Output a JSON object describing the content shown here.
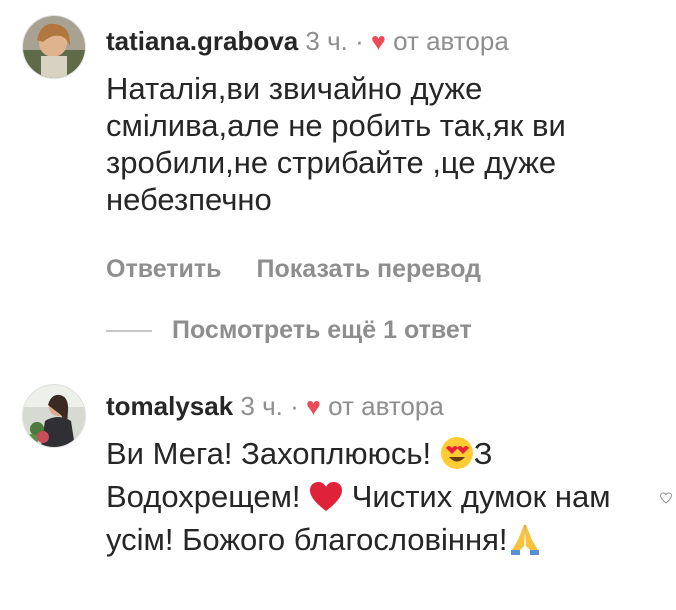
{
  "comments": [
    {
      "username": "tatiana.grabova",
      "time": "3 ч.",
      "separator": "·",
      "author_label": "от автора",
      "text": "Наталія,ви  звичайно дуже смілива,але не робить так,як ви зробили,не стрибайте ,це дуже небезпечно",
      "reply_label": "Ответить",
      "translate_label": "Показать перевод"
    },
    {
      "username": "tomalysak",
      "time": "3 ч.",
      "separator": "·",
      "author_label": "от автора",
      "text_parts": [
        "Ви Мега! Захоплююсь! ",
        "З Водохрещем! ",
        " Чистих думок нам усім! Божого благословіння!"
      ]
    }
  ],
  "more_replies_label": "Посмотреть ещё 1 ответ",
  "colors": {
    "heart": "#ed4956",
    "meta": "#8e8e8e",
    "text": "#262626"
  },
  "icons": [
    "heart-eyes-emoji",
    "red-heart-emoji",
    "praying-hands-emoji",
    "liked-heart-icon"
  ]
}
